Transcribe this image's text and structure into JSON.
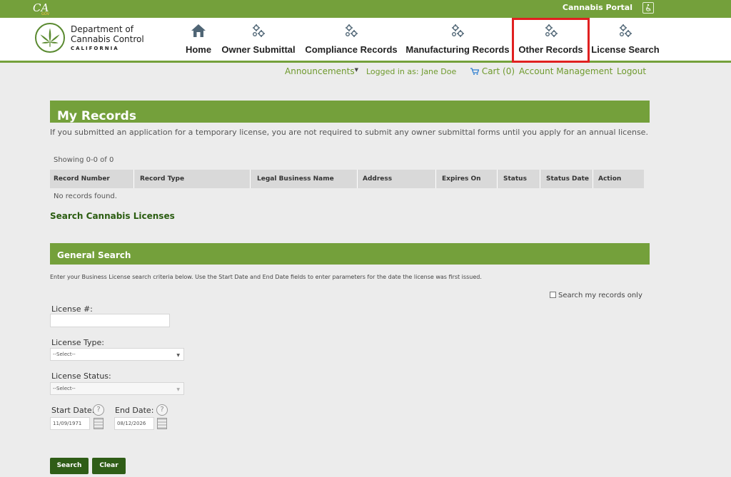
{
  "topbar": {
    "portal_label": "Cannabis Portal"
  },
  "header": {
    "dept_line1": "Department of",
    "dept_line2": "Cannabis Control",
    "dept_line3": "CALIFORNIA"
  },
  "nav": [
    {
      "label": "Home",
      "icon": "home-icon"
    },
    {
      "label": "Owner Submittal",
      "icon": "gears-icon"
    },
    {
      "label": "Compliance Records",
      "icon": "gears-icon"
    },
    {
      "label": "Manufacturing Records",
      "icon": "gears-icon"
    },
    {
      "label": "Other Records",
      "icon": "gears-icon",
      "active": true
    },
    {
      "label": "License Search",
      "icon": "gears-icon"
    }
  ],
  "account": {
    "announcements": "Announcements",
    "logged_in": "Logged in as: Jane Doe",
    "cart": "Cart (0)",
    "account_mgmt": "Account Management",
    "logout": "Logout"
  },
  "records": {
    "title": "My Records",
    "intro": "If you submitted an application for a temporary license, you are not required to submit any owner submittal forms until you apply for an annual license.",
    "showing": "Showing 0-0 of 0",
    "columns": [
      "Record Number",
      "Record Type",
      "Legal Business Name",
      "Address",
      "Expires On",
      "Status",
      "Status Date",
      "Action"
    ],
    "empty": "No records found.",
    "search_link": "Search Cannabis Licenses"
  },
  "general_search": {
    "title": "General Search",
    "help": "Enter your Business License search criteria below.  Use the Start Date and End Date fields to enter parameters for the date the license was first issued.",
    "my_records_only": "Search my records only",
    "license_no_label": "License #:",
    "license_no_value": "",
    "license_type_label": "License Type:",
    "license_type_value": "--Select--",
    "license_status_label": "License Status:",
    "license_status_value": "--Select--",
    "start_date_label": "Start Date:",
    "start_date_value": "11/09/1971",
    "end_date_label": "End Date:",
    "end_date_value": "08/12/2026",
    "help_glyph": "?",
    "search_button": "Search",
    "clear_button": "Clear"
  },
  "colors": {
    "accent": "#74a03b",
    "dark_green": "#2f5d17",
    "link": "#6f9a2e",
    "highlight": "#e02020"
  }
}
